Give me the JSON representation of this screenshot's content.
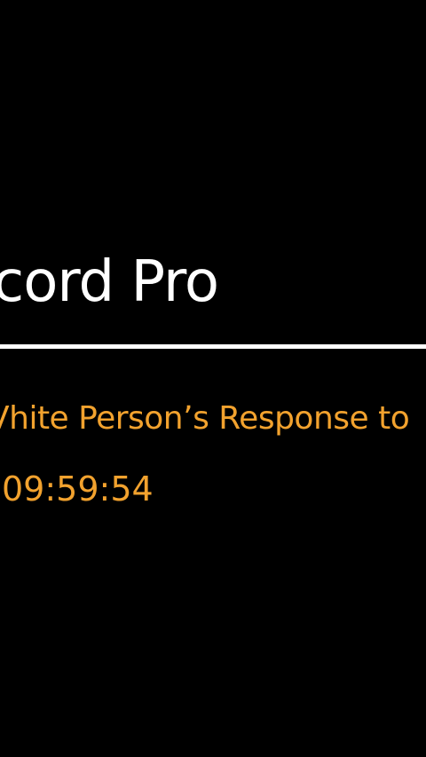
{
  "app": {
    "title": "cord Pro"
  },
  "recording": {
    "name": "Vhite Person’s Response to",
    "timestamp": "09:59:54"
  },
  "colors": {
    "background": "#000000",
    "title_text": "#ffffff",
    "accent": "#f2a22e",
    "divider": "#ffffff"
  }
}
